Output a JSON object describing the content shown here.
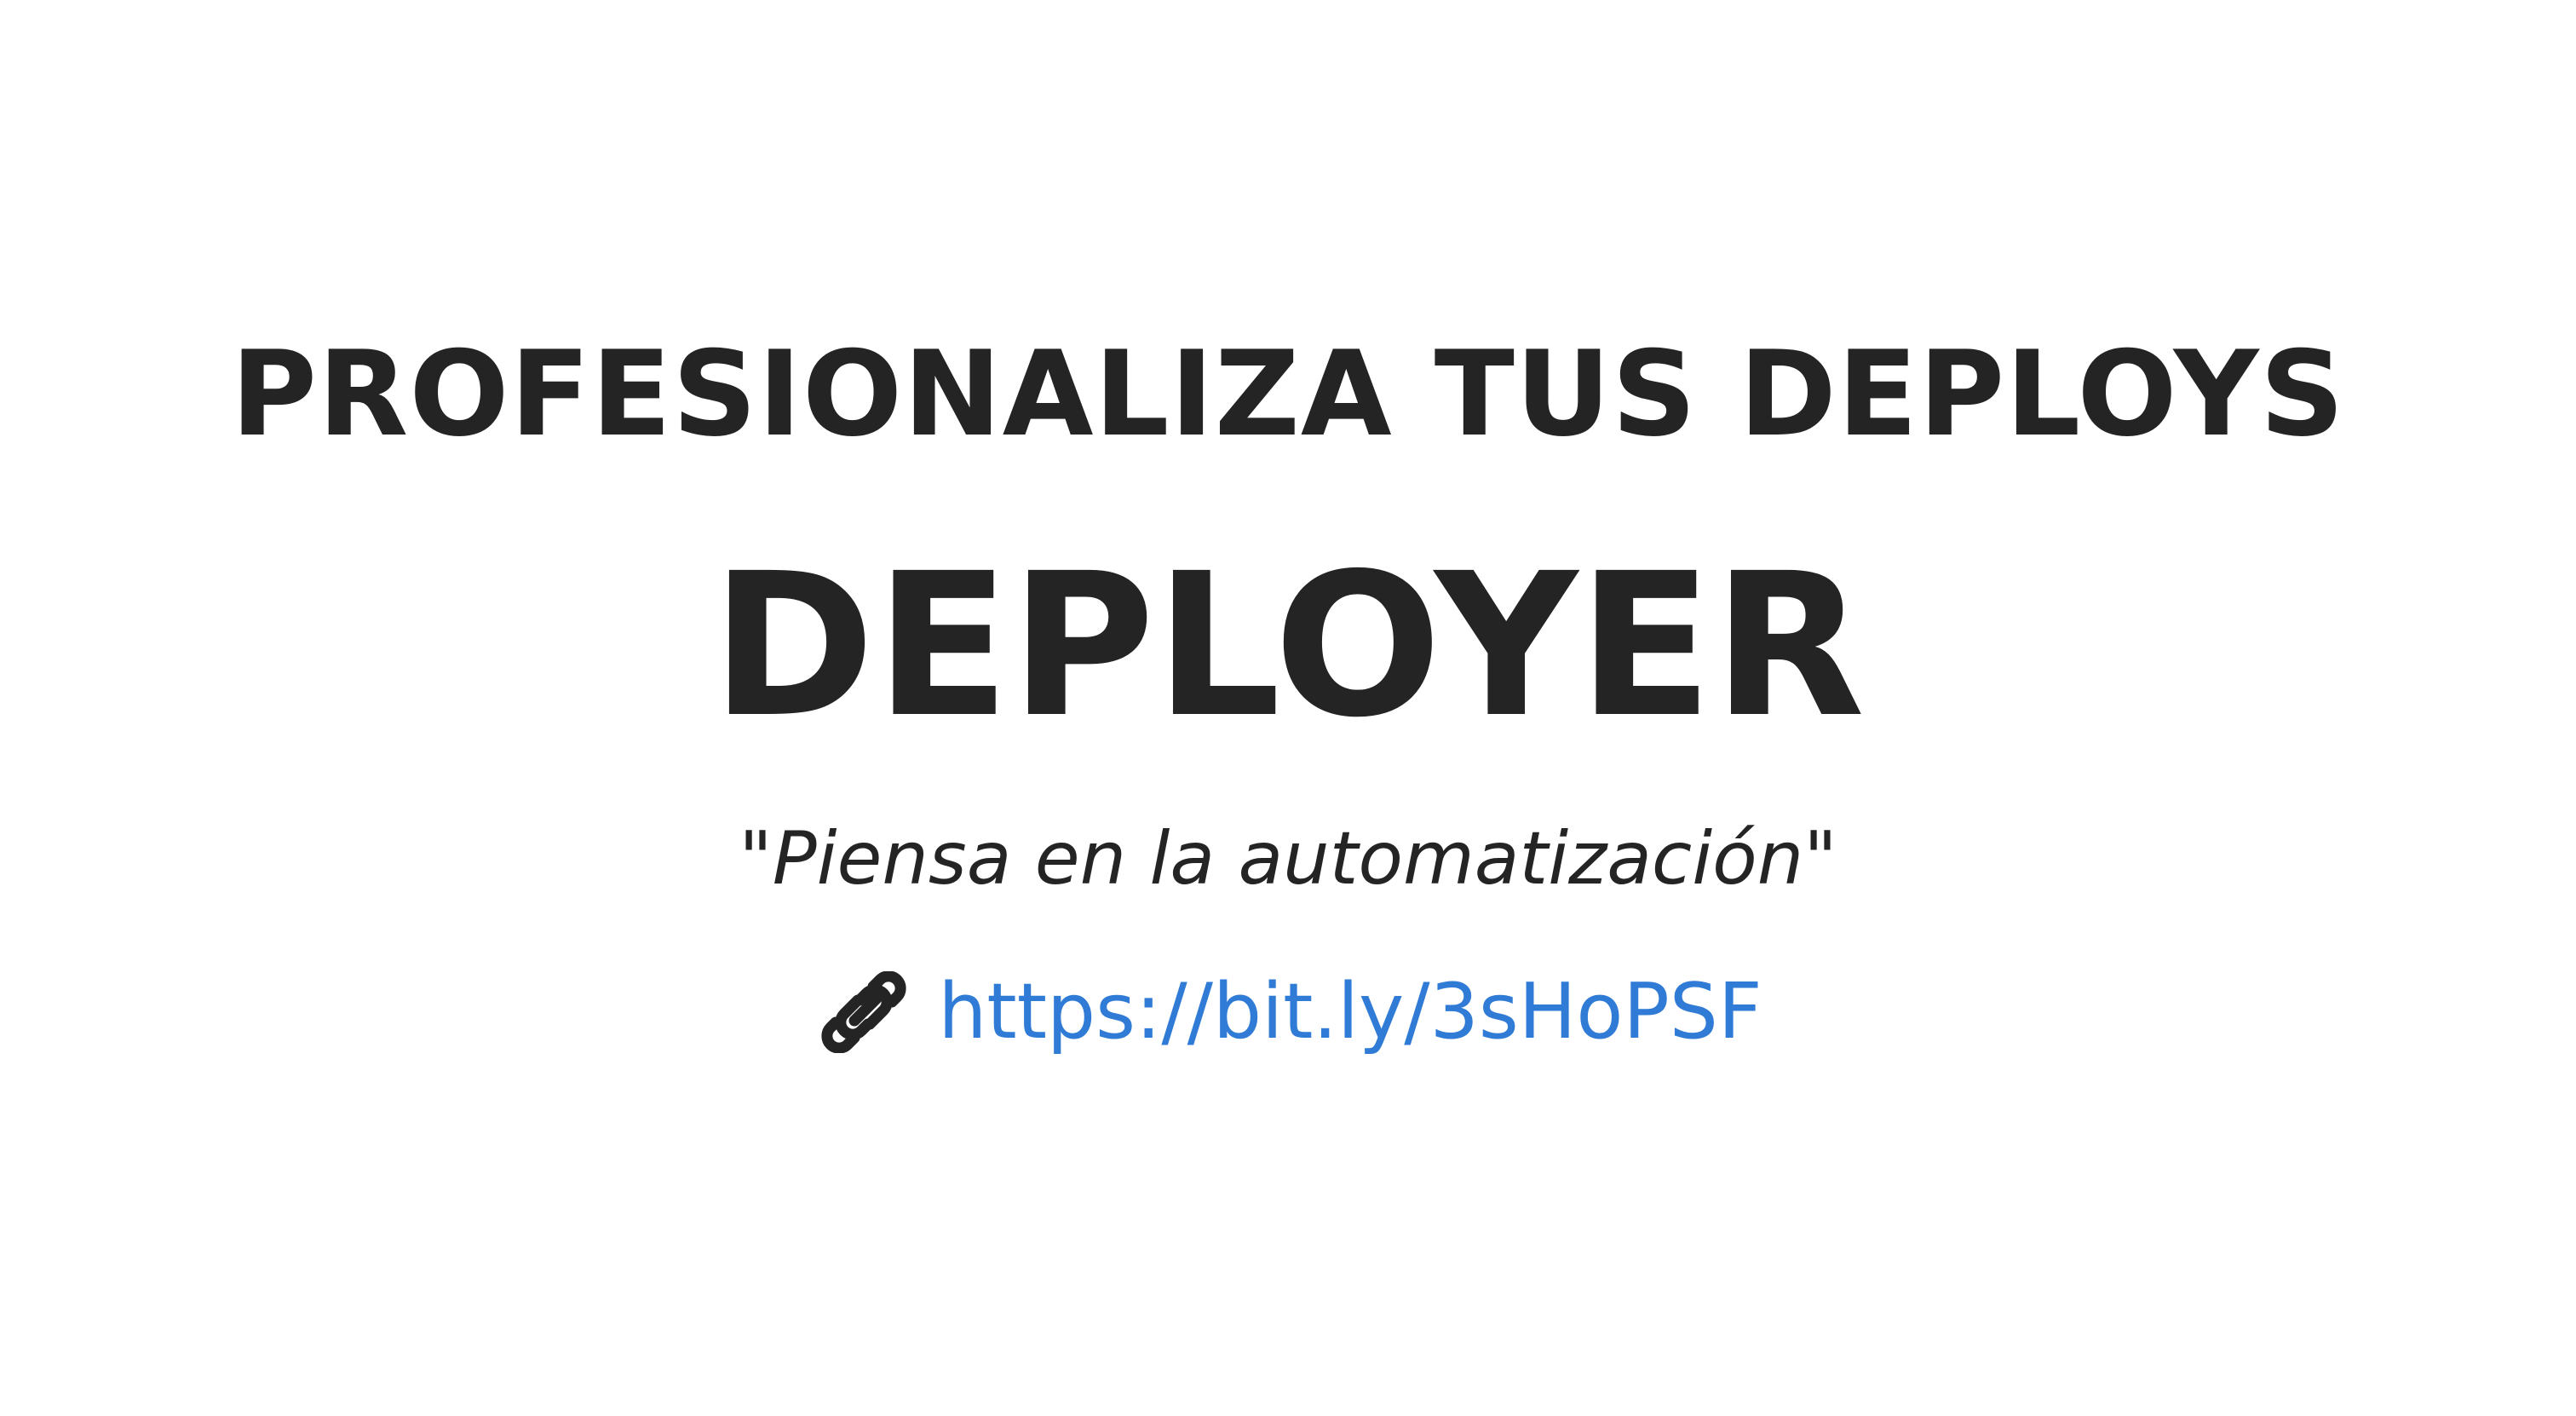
{
  "slide": {
    "tagline": "PROFESIONALIZA TUS DEPLOYS",
    "product_name": "DEPLOYER",
    "quote": "\"Piensa en la automatización\"",
    "link": {
      "icon": "link-icon",
      "url_text": "https://bit.ly/3sHoPSF"
    }
  },
  "colors": {
    "background": "#ffffff",
    "text": "#242424",
    "link": "#2f7bd6"
  }
}
